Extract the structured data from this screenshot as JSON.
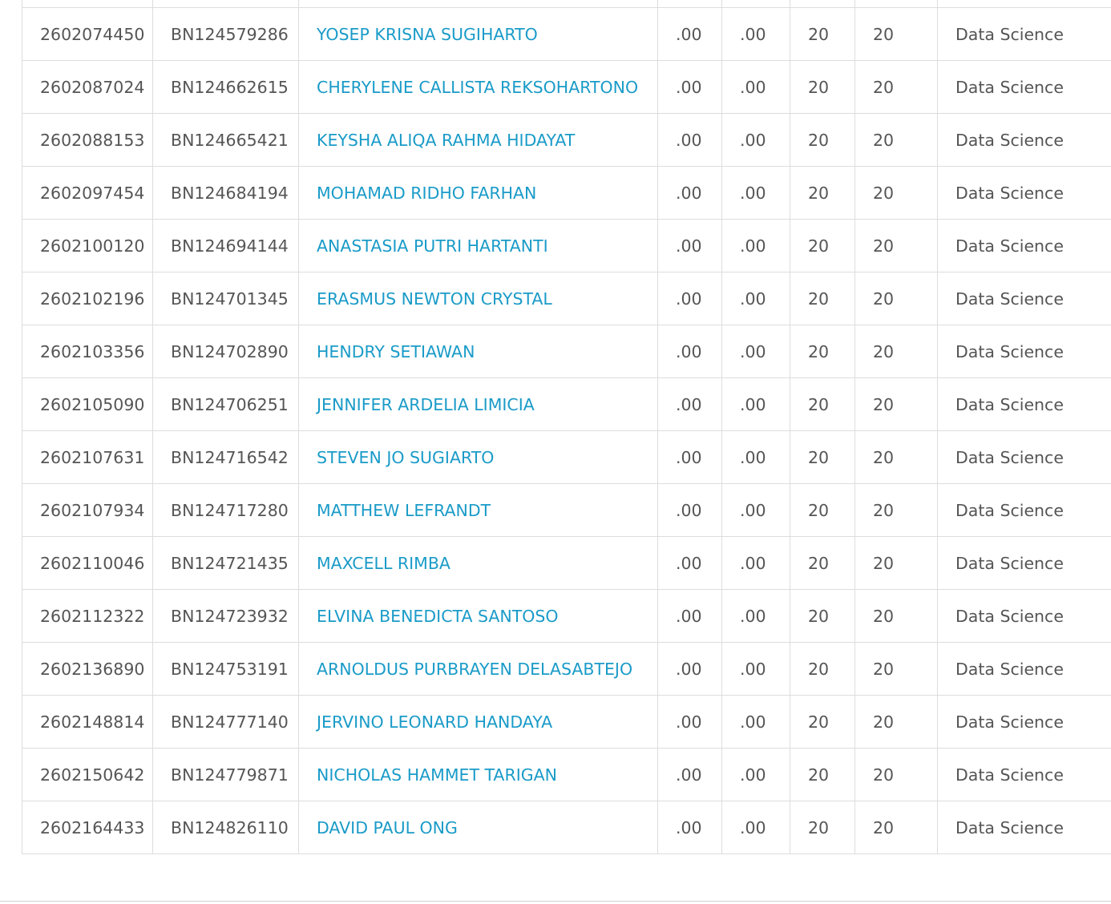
{
  "table": {
    "rows": [
      {
        "nim": "",
        "id": "",
        "name": "",
        "col4": "",
        "col5": "",
        "col6": "",
        "col7": "",
        "program": ""
      },
      {
        "nim": "2602074450",
        "id": "BN124579286",
        "name": "YOSEP KRISNA SUGIHARTO",
        "col4": ".00",
        "col5": ".00",
        "col6": "20",
        "col7": "20",
        "program": "Data Science"
      },
      {
        "nim": "2602087024",
        "id": "BN124662615",
        "name": "CHERYLENE CALLISTA REKSOHARTONO",
        "col4": ".00",
        "col5": ".00",
        "col6": "20",
        "col7": "20",
        "program": "Data Science"
      },
      {
        "nim": "2602088153",
        "id": "BN124665421",
        "name": "KEYSHA ALIQA RAHMA HIDAYAT",
        "col4": ".00",
        "col5": ".00",
        "col6": "20",
        "col7": "20",
        "program": "Data Science"
      },
      {
        "nim": "2602097454",
        "id": "BN124684194",
        "name": "MOHAMAD RIDHO FARHAN",
        "col4": ".00",
        "col5": ".00",
        "col6": "20",
        "col7": "20",
        "program": "Data Science"
      },
      {
        "nim": "2602100120",
        "id": "BN124694144",
        "name": "ANASTASIA PUTRI HARTANTI",
        "col4": ".00",
        "col5": ".00",
        "col6": "20",
        "col7": "20",
        "program": "Data Science"
      },
      {
        "nim": "2602102196",
        "id": "BN124701345",
        "name": "ERASMUS NEWTON CRYSTAL",
        "col4": ".00",
        "col5": ".00",
        "col6": "20",
        "col7": "20",
        "program": "Data Science"
      },
      {
        "nim": "2602103356",
        "id": "BN124702890",
        "name": "HENDRY SETIAWAN",
        "col4": ".00",
        "col5": ".00",
        "col6": "20",
        "col7": "20",
        "program": "Data Science"
      },
      {
        "nim": "2602105090",
        "id": "BN124706251",
        "name": "JENNIFER ARDELIA LIMICIA",
        "col4": ".00",
        "col5": ".00",
        "col6": "20",
        "col7": "20",
        "program": "Data Science"
      },
      {
        "nim": "2602107631",
        "id": "BN124716542",
        "name": "STEVEN JO SUGIARTO",
        "col4": ".00",
        "col5": ".00",
        "col6": "20",
        "col7": "20",
        "program": "Data Science"
      },
      {
        "nim": "2602107934",
        "id": "BN124717280",
        "name": "MATTHEW LEFRANDT",
        "col4": ".00",
        "col5": ".00",
        "col6": "20",
        "col7": "20",
        "program": "Data Science"
      },
      {
        "nim": "2602110046",
        "id": "BN124721435",
        "name": "MAXCELL RIMBA",
        "col4": ".00",
        "col5": ".00",
        "col6": "20",
        "col7": "20",
        "program": "Data Science"
      },
      {
        "nim": "2602112322",
        "id": "BN124723932",
        "name": "ELVINA BENEDICTA SANTOSO",
        "col4": ".00",
        "col5": ".00",
        "col6": "20",
        "col7": "20",
        "program": "Data Science"
      },
      {
        "nim": "2602136890",
        "id": "BN124753191",
        "name": "ARNOLDUS PURBRAYEN DELASABTEJO",
        "col4": ".00",
        "col5": ".00",
        "col6": "20",
        "col7": "20",
        "program": "Data Science"
      },
      {
        "nim": "2602148814",
        "id": "BN124777140",
        "name": "JERVINO LEONARD HANDAYA",
        "col4": ".00",
        "col5": ".00",
        "col6": "20",
        "col7": "20",
        "program": "Data Science"
      },
      {
        "nim": "2602150642",
        "id": "BN124779871",
        "name": "NICHOLAS HAMMET TARIGAN",
        "col4": ".00",
        "col5": ".00",
        "col6": "20",
        "col7": "20",
        "program": "Data Science"
      },
      {
        "nim": "2602164433",
        "id": "BN124826110",
        "name": "DAVID PAUL ONG",
        "col4": ".00",
        "col5": ".00",
        "col6": "20",
        "col7": "20",
        "program": "Data Science"
      }
    ]
  }
}
